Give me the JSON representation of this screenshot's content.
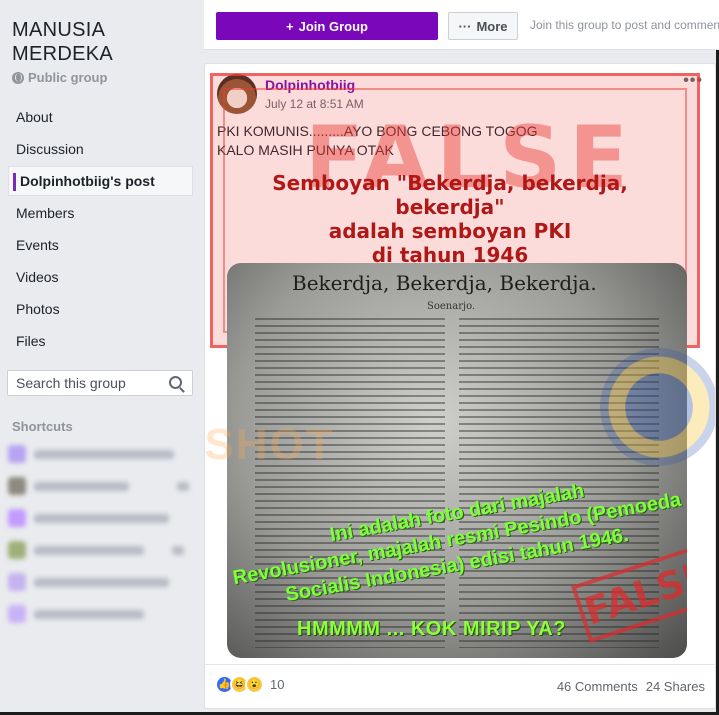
{
  "group": {
    "name_line1": "MANUSIA",
    "name_line2": "MERDEKA",
    "type": "Public group"
  },
  "nav": [
    {
      "label": "About"
    },
    {
      "label": "Discussion"
    },
    {
      "label": "Dolpinhotbiig's post",
      "active": true
    },
    {
      "label": "Members"
    },
    {
      "label": "Events"
    },
    {
      "label": "Videos"
    },
    {
      "label": "Photos"
    },
    {
      "label": "Files"
    }
  ],
  "search": {
    "placeholder": "Search this group"
  },
  "shortcuts": {
    "title": "Shortcuts"
  },
  "topbar": {
    "join_label": "Join Group",
    "more_label": "More",
    "hint": "Join this group to post and comment."
  },
  "post": {
    "author": "Dolpinhotbiig",
    "time": "July 12 at 8:51 AM",
    "text_line1": "PKI KOMUNIS.........AYO BONG CEBONG TOGOG",
    "text_line2": "KALO MASIH PUNYA OTAK",
    "image": {
      "stamp_word": "FALSE",
      "caption_line1": "Semboyan \"Bekerdja, bekerdja, bekerdja\"",
      "caption_line2": "adalah semboyan PKI",
      "caption_line3": "di tahun 1946",
      "scan_title": "Bekerdja,  Bekerdja,  Bekerdja.",
      "scan_subtitle": "Soenarjo.",
      "green_line1": "Ini adalah foto dari majalah",
      "green_line2": "Revolusioner, majalah resmi Pesindo (Pemoeda",
      "green_line3": "Socialis Indonesia) edisi tahun 1946.",
      "hmm": "HMMMM ... KOK MIRIP YA?",
      "stamp2": "FALSE",
      "watermark": "SCREENSHOT"
    },
    "reaction_count": "10",
    "comments": "46 Comments",
    "shares": "24 Shares"
  },
  "colors": {
    "brand": "#7a07ba",
    "false_red": "#eb3c37",
    "green_text": "#7dff3a"
  }
}
